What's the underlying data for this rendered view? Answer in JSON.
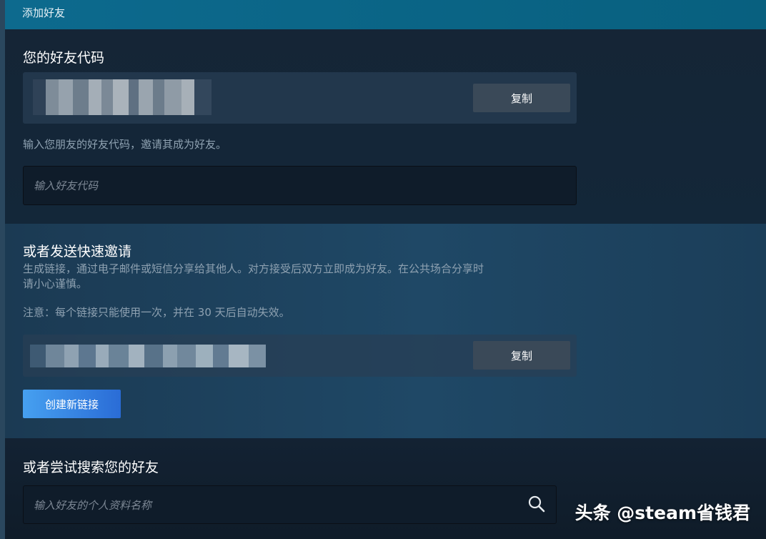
{
  "header": {
    "title": "添加好友"
  },
  "friend_code": {
    "heading": "您的好友代码",
    "copy_label": "复制",
    "instruction": "输入您朋友的好友代码，邀请其成为好友。",
    "input_placeholder": "输入好友代码"
  },
  "quick_invite": {
    "heading": "或者发送快速邀请",
    "description_line1": "生成链接，通过电子邮件或短信分享给其他人。对方接受后双方立即成为好友。在公共场合分享时",
    "description_line2": "请小心谨慎。",
    "note": "注意：每个链接只能使用一次，并在 30 天后自动失效。",
    "copy_label": "复制",
    "create_link_label": "创建新链接"
  },
  "search": {
    "heading": "或者尝试搜索您的好友",
    "input_placeholder": "输入好友的个人资料名称",
    "icon": "search-icon"
  },
  "watermark": {
    "text": "头条 @steam省钱君"
  },
  "colors": {
    "header": "#0d6a8e",
    "background": "#1b2838",
    "accent_button": "#46a0f0",
    "copy_button": "#3a4958"
  }
}
